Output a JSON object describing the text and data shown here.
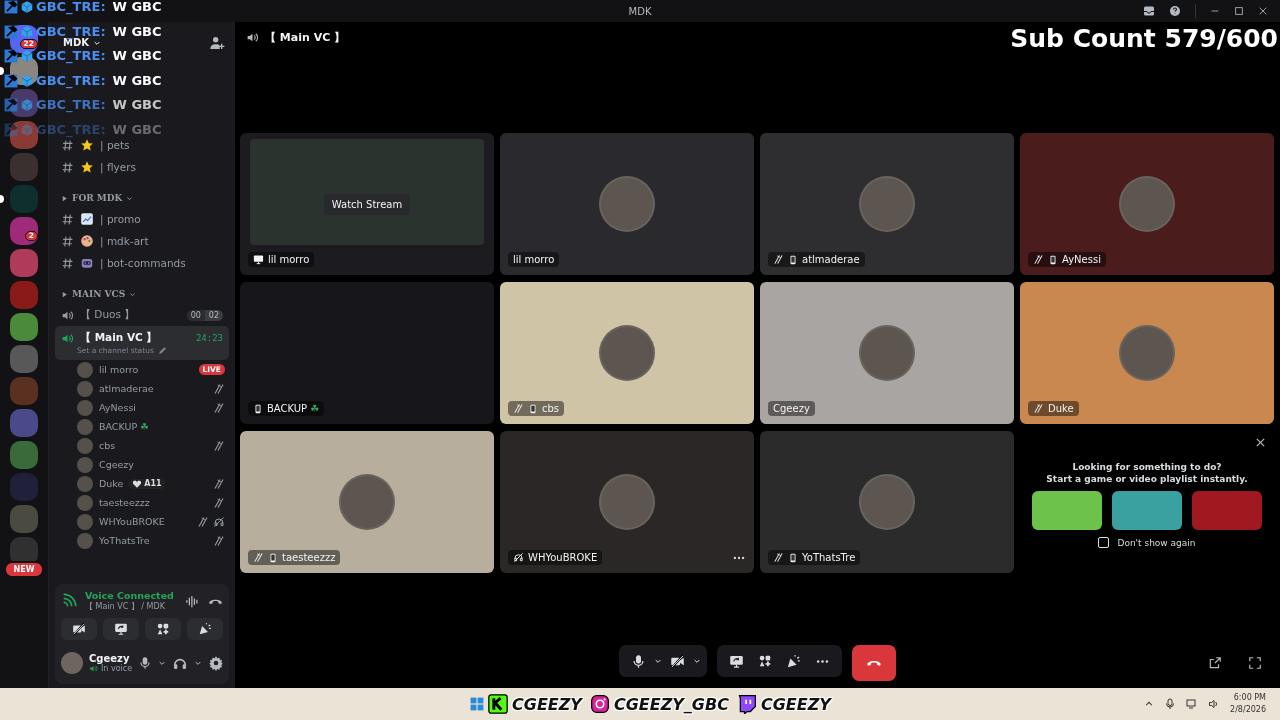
{
  "window": {
    "title": "MDK"
  },
  "overlay_chat": [
    {
      "user": "GBC_TRE:",
      "message": "W GBC"
    },
    {
      "user": "GBC_TRE:",
      "message": "W GBC"
    },
    {
      "user": "GBC_TRE:",
      "message": "W GBC"
    },
    {
      "user": "GBC_TRE:",
      "message": "W GBC"
    },
    {
      "user": "GBC_TRE:",
      "message": "W GBC"
    },
    {
      "user": "GBC_TRE:",
      "message": "W GBC"
    }
  ],
  "sub_count": "Sub Count 579/600",
  "servers": [
    {
      "color": "#5865f2",
      "unread": false,
      "badge": "22"
    },
    {
      "color": "#8a8680",
      "unread": true
    },
    {
      "color": "#4a3a6a",
      "unread": false
    },
    {
      "color": "#8a3a34",
      "unread": false
    },
    {
      "color": "#3a3030",
      "unread": false
    },
    {
      "color": "#0f2e2e",
      "unread": true
    },
    {
      "color": "#a02a7a",
      "unread": false,
      "badge": "2"
    },
    {
      "color": "#b03a5a",
      "unread": false
    },
    {
      "color": "#8a1a1a",
      "unread": false
    },
    {
      "color": "#4a8a3a",
      "unread": false
    },
    {
      "color": "#585858",
      "unread": false
    },
    {
      "color": "#5a3020",
      "unread": false
    },
    {
      "color": "#4a4a8a",
      "unread": false
    },
    {
      "color": "#3a6a3a",
      "unread": false
    },
    {
      "color": "#20203a",
      "unread": false
    },
    {
      "color": "#4a4a40",
      "unread": false
    },
    {
      "color": "#303030",
      "unread": false,
      "badge": "NEW"
    }
  ],
  "sidebar": {
    "server_name": "MDK",
    "groups": [
      {
        "channels": [
          {
            "kind": "star",
            "name": "| pets"
          },
          {
            "kind": "star",
            "name": "| flyers"
          }
        ]
      },
      {
        "name": "FOR MDK",
        "channels": [
          {
            "kind": "chart",
            "name": "| promo"
          },
          {
            "kind": "palette",
            "name": "| mdk-art"
          },
          {
            "kind": "robot",
            "name": "| bot-commands"
          }
        ]
      },
      {
        "name": "MAIN VCS",
        "channels": [
          {
            "kind": "voice",
            "name": "【 Duos 】",
            "selected": false,
            "counts": [
              "00",
              "02"
            ]
          },
          {
            "kind": "voice",
            "name": "【 Main VC 】",
            "selected": true,
            "time": "24:23",
            "status": "Set a channel status",
            "members": [
              {
                "name": "lil morro",
                "badge": "LIVE",
                "muted": false,
                "deafened": false
              },
              {
                "name": "atlmaderae",
                "muted": true,
                "deafened": false
              },
              {
                "name": "AyNessi",
                "muted": true,
                "deafened": false
              },
              {
                "name": "BACKUP",
                "flair": "☘",
                "muted": false,
                "deafened": false
              },
              {
                "name": "cbs",
                "muted": true,
                "deafened": false
              },
              {
                "name": "Cgeezy",
                "muted": false,
                "deafened": false
              },
              {
                "name": "Duke",
                "tag": "A11",
                "muted": true,
                "deafened": false
              },
              {
                "name": "taesteezzz",
                "muted": true,
                "deafened": false
              },
              {
                "name": "WHYouBROKE",
                "muted": true,
                "deafened": true
              },
              {
                "name": "YoThatsTre",
                "muted": true,
                "deafened": false
              }
            ]
          }
        ]
      }
    ]
  },
  "voice_panel": {
    "status": "Voice Connected",
    "location": "【 Main VC 】 / MDK",
    "user": "Cgeezy",
    "user_status": "In voice"
  },
  "channel_header": "【 Main VC 】",
  "tiles": [
    {
      "kind": "stream",
      "name": "lil morro",
      "color": "#1c1c20",
      "action": "Watch Stream",
      "muted": false,
      "mobile": false
    },
    {
      "kind": "user",
      "name": "lil morro",
      "color": "#2a2a2e",
      "muted": false,
      "mobile": false
    },
    {
      "kind": "user",
      "name": "atlmaderae",
      "color": "#2e2e31",
      "muted": true,
      "mobile": true
    },
    {
      "kind": "user",
      "name": "AyNessi",
      "color": "#4a1c1c",
      "muted": true,
      "mobile": true
    },
    {
      "kind": "empty",
      "name": "BACKUP",
      "flair": "☘",
      "color": "#17171b",
      "muted": false,
      "mobile": true
    },
    {
      "kind": "user",
      "name": "cbs",
      "color": "#cfc4a6",
      "muted": true,
      "mobile": true
    },
    {
      "kind": "user",
      "name": "Cgeezy",
      "color": "#a9a5a2",
      "muted": false,
      "mobile": false
    },
    {
      "kind": "user",
      "name": "Duke",
      "color": "#c8884f",
      "muted": true,
      "mobile": false
    },
    {
      "kind": "user",
      "name": "taesteezzz",
      "color": "#b7ae9d",
      "muted": true,
      "mobile": true
    },
    {
      "kind": "user",
      "name": "WHYouBROKE",
      "color": "#2a2726",
      "muted": false,
      "deafened": true,
      "mobile": false,
      "hovered": true
    },
    {
      "kind": "user",
      "name": "YoThatsTre",
      "color": "#2c2b2b",
      "muted": true,
      "mobile": true
    }
  ],
  "activity_prompt": {
    "title": "Looking for something to do?",
    "subtitle": "Start a game or video playlist instantly.",
    "games": [
      {
        "color": "#6cc24a"
      },
      {
        "color": "#3aa0a0"
      },
      {
        "color": "#a01820"
      }
    ],
    "checkbox": {
      "label": "Don't show again",
      "checked": false
    }
  },
  "taskbar": {
    "socials": [
      {
        "kind": "kick",
        "handle": "CGEEZY"
      },
      {
        "kind": "instagram",
        "handle": "CGEEZY_GBC"
      },
      {
        "kind": "twitch",
        "handle": "CGEEZY"
      }
    ],
    "time": "6:00 PM",
    "date": "2/8/2026"
  }
}
